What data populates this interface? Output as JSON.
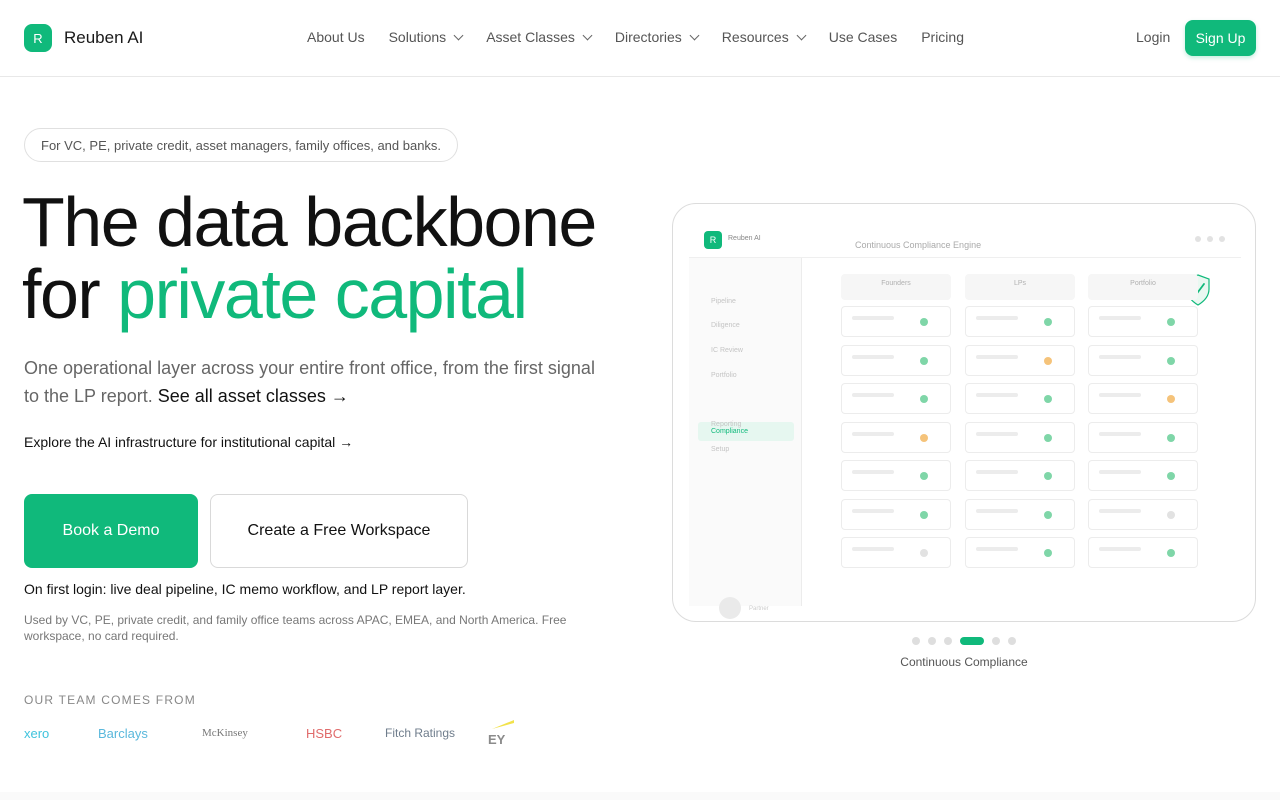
{
  "brand": {
    "mark": "R",
    "name": "Reuben AI",
    "accent": "#10b97b"
  },
  "nav": {
    "items": [
      {
        "label": "About Us",
        "dropdown": false
      },
      {
        "label": "Solutions",
        "dropdown": true
      },
      {
        "label": "Asset Classes",
        "dropdown": true
      },
      {
        "label": "Directories",
        "dropdown": true
      },
      {
        "label": "Resources",
        "dropdown": true
      },
      {
        "label": "Use Cases",
        "dropdown": false
      },
      {
        "label": "Pricing",
        "dropdown": false
      }
    ],
    "login": "Login",
    "signup": "Sign Up"
  },
  "hero": {
    "pill": "For VC, PE, private credit, asset managers, family offices, and banks.",
    "title_line1": "The data backbone",
    "title_for": "for ",
    "title_accent": "private capital",
    "subtitle": "One operational layer across your entire front office, from the first signal to the LP report. ",
    "subtitle_link": "See all asset classes →",
    "explore": "Explore the AI infrastructure for institutional capital →",
    "cta_primary": "Book a Demo",
    "cta_secondary": "Create a Free Workspace",
    "first_login": "On first login: live deal pipeline, IC memo workflow, and LP report layer.",
    "used_by": "Used by VC, PE, private credit, and family office teams across APAC, EMEA, and North America. Free workspace, no card required.",
    "team_label": "OUR TEAM COMES FROM",
    "team_logos": [
      "xero",
      "Barclays",
      "McKinsey",
      "HSBC",
      "Fitch Ratings",
      "EY"
    ]
  },
  "mockup": {
    "mark": "R",
    "app_name": "Reuben AI",
    "title": "Continuous Compliance Engine",
    "sidebar": [
      "Pipeline",
      "Diligence",
      "IC Review",
      "Portfolio",
      "Compliance",
      "Reporting",
      "Setup"
    ],
    "active_item": "Compliance",
    "user": "Partner",
    "columns": [
      "Founders",
      "LPs",
      "Portfolio"
    ],
    "status_grid": [
      [
        "green",
        "green",
        "green"
      ],
      [
        "green",
        "amber",
        "green"
      ],
      [
        "green",
        "green",
        "amber"
      ],
      [
        "amber",
        "green",
        "green"
      ],
      [
        "green",
        "green",
        "green"
      ],
      [
        "green",
        "green",
        "grey"
      ],
      [
        "grey",
        "green",
        "green"
      ]
    ],
    "status_colors": {
      "green": "#7fd6a8",
      "amber": "#f5c37a",
      "grey": "#e2e2e2"
    }
  },
  "carousel": {
    "count": 6,
    "active_index": 3,
    "caption": "Continuous Compliance"
  }
}
